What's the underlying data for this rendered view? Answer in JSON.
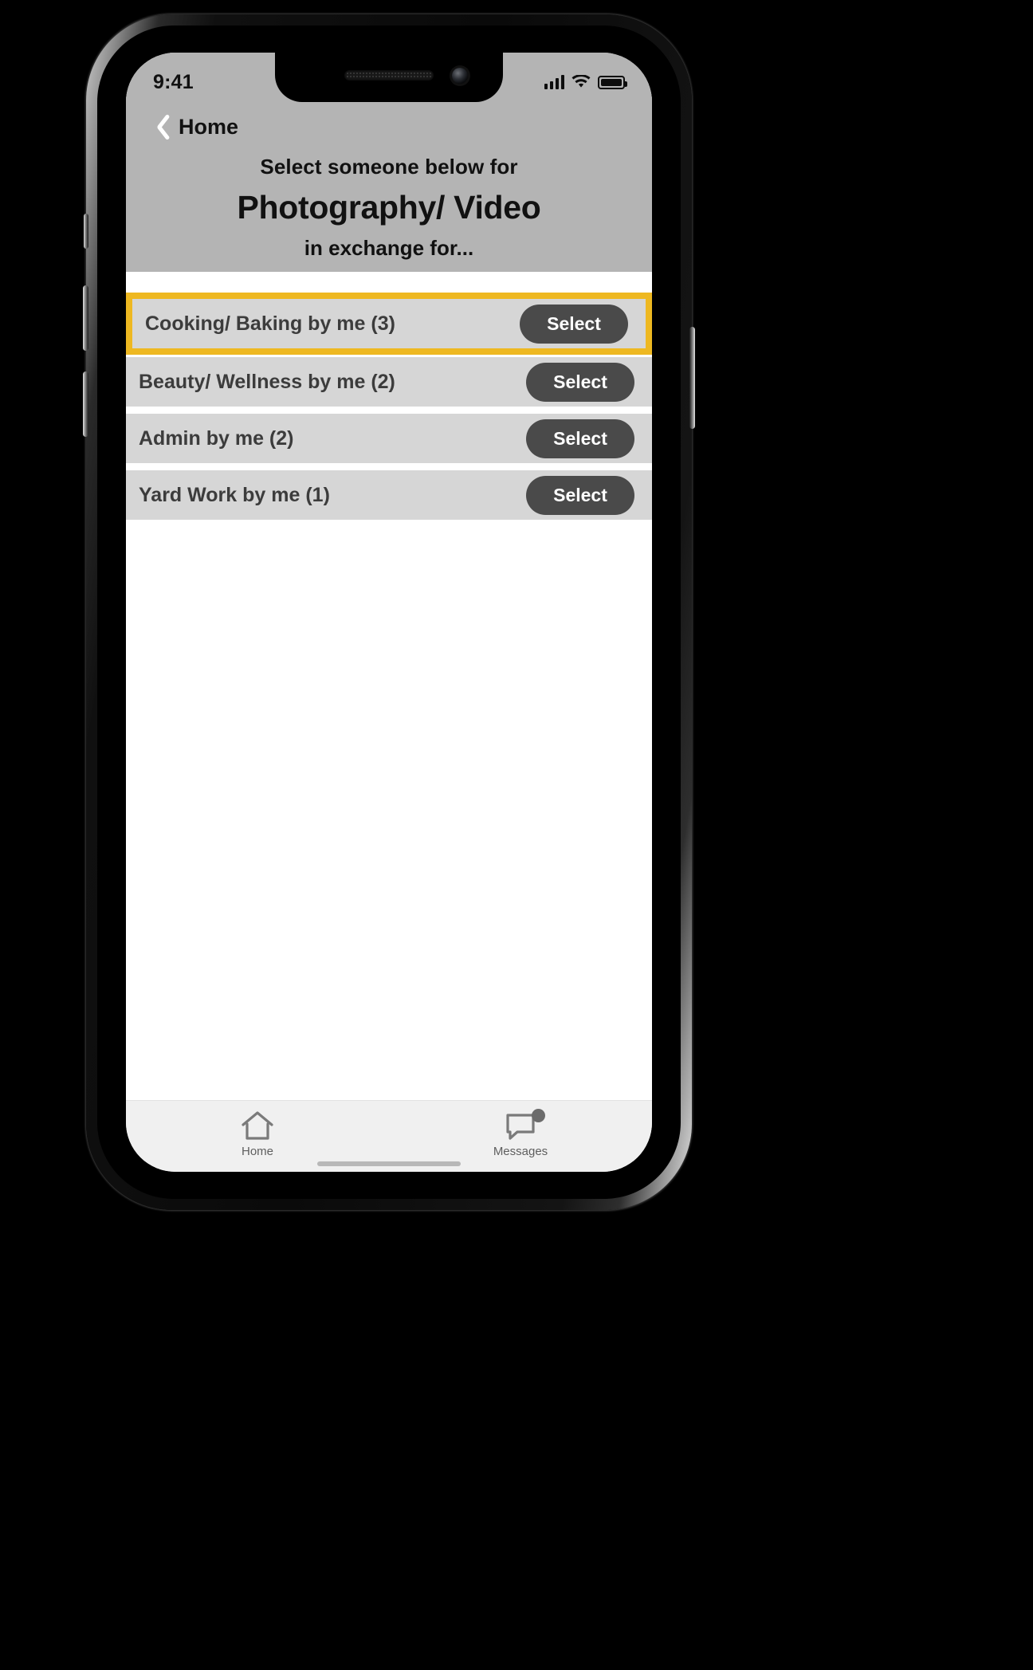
{
  "status_bar": {
    "time": "9:41",
    "signal_icon": "cellular-signal-icon",
    "wifi_icon": "wifi-icon",
    "battery_icon": "battery-full-icon"
  },
  "nav": {
    "back_icon": "chevron-left-icon",
    "back_label": "Home"
  },
  "header": {
    "line1": "Select someone below for",
    "title": "Photography/ Video",
    "line3": "in exchange for...",
    "background_color": "#b4b4b4"
  },
  "highlight_color": "#eeb821",
  "list": {
    "rows": [
      {
        "label": "Cooking/ Baking by me (3)",
        "action": "Select",
        "highlighted": true
      },
      {
        "label": "Beauty/ Wellness by me (2)",
        "action": "Select",
        "highlighted": false
      },
      {
        "label": "Admin by me (2)",
        "action": "Select",
        "highlighted": false
      },
      {
        "label": "Yard Work by me  (1)",
        "action": "Select",
        "highlighted": false
      }
    ]
  },
  "tabbar": {
    "tabs": [
      {
        "label": "Home",
        "icon": "home-icon",
        "badge": false
      },
      {
        "label": "Messages",
        "icon": "message-bubble-icon",
        "badge": true
      }
    ]
  }
}
